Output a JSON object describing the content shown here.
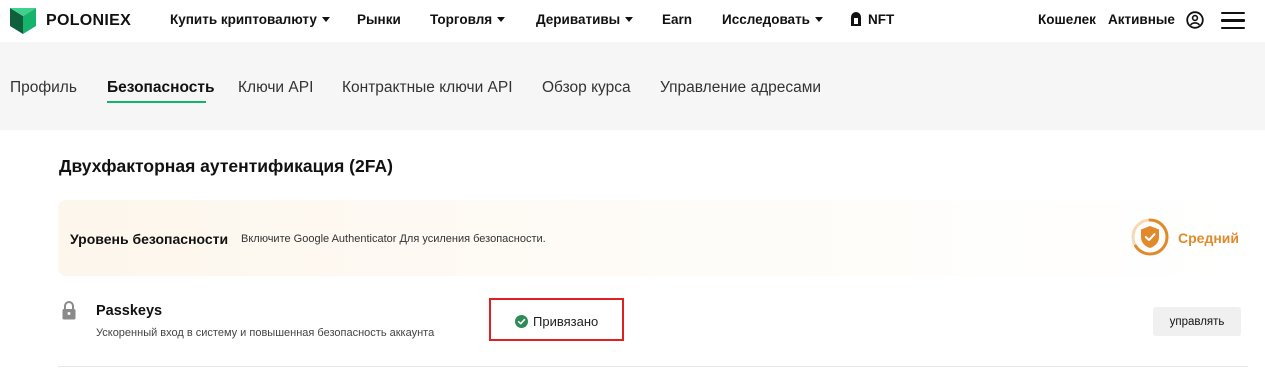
{
  "brand": {
    "name": "POLONIEX",
    "accent": "#15b36b"
  },
  "topnav": {
    "items": [
      {
        "label": "Купить криптовалюту",
        "has_caret": true
      },
      {
        "label": "Рынки",
        "has_caret": false
      },
      {
        "label": "Торговля",
        "has_caret": true
      },
      {
        "label": "Деривативы",
        "has_caret": true
      },
      {
        "label": "Earn",
        "has_caret": false
      },
      {
        "label": "Исследовать",
        "has_caret": true
      },
      {
        "label": "NFT",
        "has_caret": false
      }
    ],
    "wallet": "Кошелек",
    "assets": "Активные"
  },
  "tabs": [
    {
      "label": "Профиль"
    },
    {
      "label": "Безопасность",
      "active": true
    },
    {
      "label": "Ключи API"
    },
    {
      "label": "Контрактные ключи API"
    },
    {
      "label": "Обзор курса"
    },
    {
      "label": "Управление адресами"
    }
  ],
  "security": {
    "section_title": "Двухфакторная аутентификация (2FA)",
    "level_label": "Уровень безопасности",
    "level_hint": "Включите Google Authenticator Для усиления безопасности.",
    "level_value": "Средний",
    "level_color": "#e08a2c",
    "level_progress": 0.66
  },
  "passkeys": {
    "title": "Passkeys",
    "description": "Ускоренный вход в систему и повышенная безопасность аккаунта",
    "status": "Привязано",
    "status_color": "#2e8b57",
    "manage_label": "управлять"
  }
}
